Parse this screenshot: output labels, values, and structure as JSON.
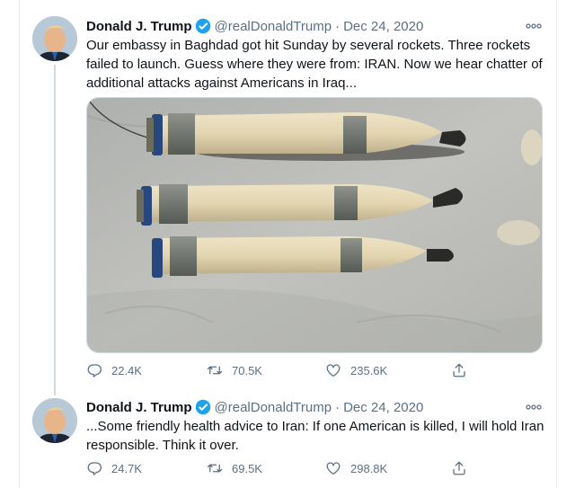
{
  "tweets": [
    {
      "name": "Donald J. Trump",
      "handle": "@realDonaldTrump",
      "separator": "·",
      "date": "Dec 24, 2020",
      "text": "Our embassy in Baghdad got hit Sunday by several rockets. Three rockets failed to launch. Guess where they were from: IRAN. Now we hear chatter of additional attacks against Americans in Iraq...",
      "replies": "22.4K",
      "retweets": "70.5K",
      "likes": "235.6K"
    },
    {
      "name": "Donald J. Trump",
      "handle": "@realDonaldTrump",
      "separator": "·",
      "date": "Dec 24, 2020",
      "text": "...Some friendly health advice to Iran: If one American is killed, I will hold Iran responsible. Think it over.",
      "replies": "24.7K",
      "retweets": "69.5K",
      "likes": "298.8K"
    }
  ],
  "icons": {
    "verified": "verified-badge-icon",
    "more": "more-options-icon",
    "reply": "reply-icon",
    "retweet": "retweet-icon",
    "like": "heart-icon",
    "share": "share-icon"
  },
  "colors": {
    "text_primary": "#0f1419",
    "text_secondary": "#5b7083",
    "verified_blue": "#1da1f2"
  }
}
